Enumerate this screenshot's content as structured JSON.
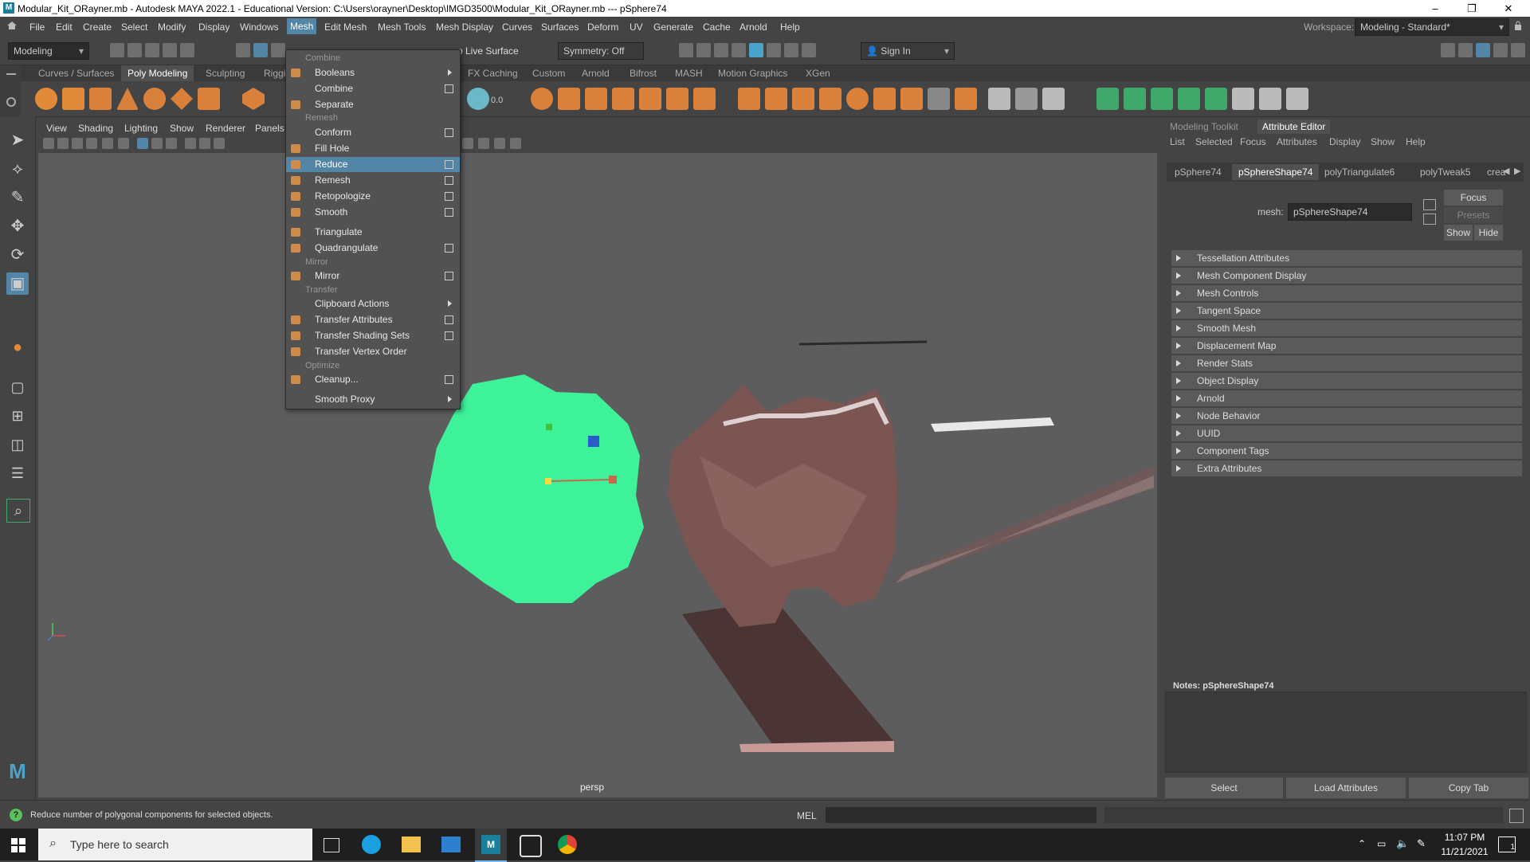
{
  "titlebar": {
    "title": "Modular_Kit_ORayner.mb - Autodesk MAYA 2022.1 - Educational Version: C:\\Users\\orayner\\Desktop\\IMGD3500\\Modular_Kit_ORayner.mb  ---  pSphere74",
    "minimize": "–",
    "maximize": "❐",
    "close": "✕"
  },
  "menubar": {
    "items": [
      "File",
      "Edit",
      "Create",
      "Select",
      "Modify",
      "Display",
      "Windows",
      "Mesh",
      "Edit Mesh",
      "Mesh Tools",
      "Mesh Display",
      "Curves",
      "Surfaces",
      "Deform",
      "UV",
      "Generate",
      "Cache",
      "Arnold",
      "Help"
    ],
    "workspace_label": "Workspace:",
    "workspace_value": "Modeling - Standard*"
  },
  "statusline": {
    "mode": "Modeling",
    "live_surface": "o Live Surface",
    "symmetry": "Symmetry: Off",
    "sign_in": "Sign In"
  },
  "shelf": {
    "tabs": [
      "Curves / Surfaces",
      "Poly Modeling",
      "Sculpting",
      "Riggi",
      "FX Caching",
      "Custom",
      "Arnold",
      "Bifrost",
      "MASH",
      "Motion Graphics",
      "XGen"
    ],
    "active": "Poly Modeling",
    "readout": "0.0"
  },
  "viewport": {
    "menu": [
      "View",
      "Shading",
      "Lighting",
      "Show",
      "Renderer",
      "Panels"
    ],
    "camera": "persp"
  },
  "mesh_menu": {
    "sections": [
      {
        "header": "Combine",
        "items": [
          {
            "label": "Booleans",
            "submenu": true
          },
          {
            "label": "Combine",
            "box": true
          },
          {
            "label": "Separate"
          }
        ]
      },
      {
        "header": "Remesh",
        "items": [
          {
            "label": "Conform",
            "box": true
          },
          {
            "label": "Fill Hole"
          },
          {
            "label": "Reduce",
            "box": true,
            "highlight": true
          },
          {
            "label": "Remesh",
            "box": true
          },
          {
            "label": "Retopologize",
            "box": true
          },
          {
            "label": "Smooth",
            "box": true
          },
          {
            "label": "Triangulate"
          },
          {
            "label": "Quadrangulate",
            "box": true
          }
        ]
      },
      {
        "header": "Mirror",
        "items": [
          {
            "label": "Mirror",
            "box": true
          }
        ]
      },
      {
        "header": "Transfer",
        "items": [
          {
            "label": "Clipboard Actions",
            "submenu": true
          },
          {
            "label": "Transfer Attributes",
            "box": true
          },
          {
            "label": "Transfer Shading Sets",
            "box": true
          },
          {
            "label": "Transfer Vertex Order"
          }
        ]
      },
      {
        "header": "Optimize",
        "items": [
          {
            "label": "Cleanup...",
            "box": true
          },
          {
            "label": "Smooth Proxy",
            "submenu": true
          }
        ]
      }
    ]
  },
  "attribute_editor": {
    "tabs": [
      "Modeling Toolkit",
      "Attribute Editor"
    ],
    "menu": [
      "List",
      "Selected",
      "Focus",
      "Attributes",
      "Display",
      "Show",
      "Help"
    ],
    "node_tabs": [
      "pSphere74",
      "pSphereShape74",
      "polyTriangulate6",
      "polyTweak5",
      "crea"
    ],
    "active_node": "pSphereShape74",
    "mesh_label": "mesh:",
    "mesh_value": "pSphereShape74",
    "focus": "Focus",
    "presets": "Presets",
    "show": "Show",
    "hide": "Hide",
    "sections": [
      "Tessellation Attributes",
      "Mesh Component Display",
      "Mesh Controls",
      "Tangent Space",
      "Smooth Mesh",
      "Displacement Map",
      "Render Stats",
      "Object Display",
      "Arnold",
      "Node Behavior",
      "UUID",
      "Component Tags",
      "Extra Attributes"
    ],
    "notes_label": "Notes:  pSphereShape74",
    "buttons": [
      "Select",
      "Load Attributes",
      "Copy Tab"
    ]
  },
  "helpline": {
    "text": "Reduce number of polygonal components for selected objects.",
    "mel": "MEL"
  },
  "taskbar": {
    "search_placeholder": "Type here to search",
    "time": "11:07 PM",
    "date": "11/21/2021",
    "notification_count": "1"
  },
  "colors": {
    "highlight": "#5285a6",
    "green_mesh": "#3ef29a",
    "rock": "#7a5552"
  }
}
